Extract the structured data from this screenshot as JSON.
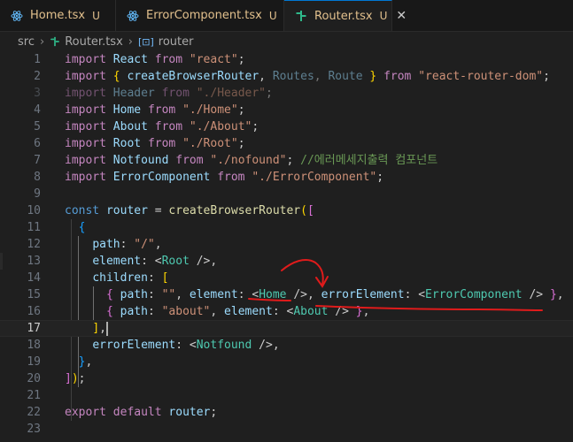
{
  "tabs": [
    {
      "label": "Home.tsx",
      "badge": "U",
      "icon": "react-icon"
    },
    {
      "label": "ErrorComponent.tsx",
      "badge": "U",
      "icon": "react-icon"
    },
    {
      "label": "Router.tsx",
      "badge": "U",
      "icon": "react-router-icon",
      "close": "✕"
    }
  ],
  "breadcrumb": {
    "folder": "src",
    "file": "Router.tsx",
    "symbol": "router"
  },
  "lines": {
    "n1": "1",
    "n2": "2",
    "n3": "3",
    "n4": "4",
    "n5": "5",
    "n6": "6",
    "n7": "7",
    "n8": "8",
    "n9": "9",
    "n10": "10",
    "n11": "11",
    "n12": "12",
    "n13": "13",
    "n14": "14",
    "n15": "15",
    "n16": "16",
    "n17": "17",
    "n18": "18",
    "n19": "19",
    "n20": "20",
    "n21": "21",
    "n22": "22",
    "n23": "23"
  },
  "code": {
    "import": "import",
    "from": "from",
    "const": "const",
    "export": "export",
    "default": "default",
    "l1_id": "React",
    "l1_str": "\"react\"",
    "l2_a": "createBrowserRouter",
    "l2_b": "Routes",
    "l2_c": "Route",
    "l2_str": "\"react-router-dom\"",
    "l3_id": "Header",
    "l3_str": "\"./Header\"",
    "l4_id": "Home",
    "l4_str": "\"./Home\"",
    "l5_id": "About",
    "l5_str": "\"./About\"",
    "l6_id": "Root",
    "l6_str": "\"./Root\"",
    "l7_id": "Notfound",
    "l7_str": "\"./nofound\"",
    "l7_cmt": "//에러메세지출력 컴포넌트",
    "l8_id": "ErrorComponent",
    "l8_str": "\"./ErrorComponent\"",
    "l10_id": "router",
    "l10_fn": "createBrowserRouter",
    "path": "path",
    "element": "element",
    "children": "children",
    "errorElement": "errorElement",
    "l12_str": "\"/\"",
    "root": "Root",
    "l15_str": "\"\"",
    "home": "Home",
    "errcomp": "ErrorComponent",
    "l16_str": "\"about\"",
    "about": "About",
    "notfound": "Notfound",
    "l22_id": "router"
  }
}
